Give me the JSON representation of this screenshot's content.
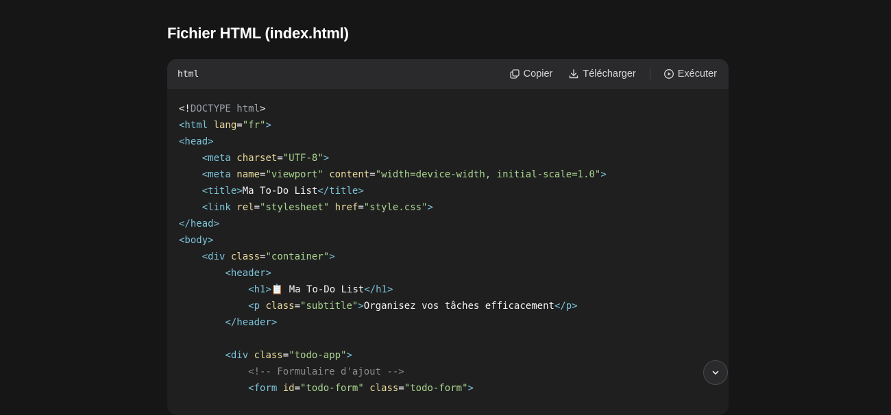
{
  "heading": "Fichier HTML (index.html)",
  "codeblock": {
    "language": "html",
    "copy_label": "Copier",
    "download_label": "Télécharger",
    "run_label": "Exécuter",
    "lines": [
      [
        [
          "p",
          "<!"
        ],
        [
          "d",
          "DOCTYPE html"
        ],
        [
          "p",
          ">"
        ]
      ],
      [
        [
          "t",
          "<html "
        ],
        [
          "a",
          "lang"
        ],
        [
          "p",
          "="
        ],
        [
          "s",
          "\"fr\""
        ],
        [
          "t",
          ">"
        ]
      ],
      [
        [
          "t",
          "<head>"
        ]
      ],
      [
        [
          "p",
          "    "
        ],
        [
          "t",
          "<meta "
        ],
        [
          "a",
          "charset"
        ],
        [
          "p",
          "="
        ],
        [
          "s",
          "\"UTF-8\""
        ],
        [
          "t",
          ">"
        ]
      ],
      [
        [
          "p",
          "    "
        ],
        [
          "t",
          "<meta "
        ],
        [
          "a",
          "name"
        ],
        [
          "p",
          "="
        ],
        [
          "s",
          "\"viewport\""
        ],
        [
          "p",
          " "
        ],
        [
          "a",
          "content"
        ],
        [
          "p",
          "="
        ],
        [
          "s",
          "\"width=device-width, initial-scale=1.0\""
        ],
        [
          "t",
          ">"
        ]
      ],
      [
        [
          "p",
          "    "
        ],
        [
          "t",
          "<title>"
        ],
        [
          "p",
          "Ma To-Do List"
        ],
        [
          "t",
          "</title>"
        ]
      ],
      [
        [
          "p",
          "    "
        ],
        [
          "t",
          "<link "
        ],
        [
          "a",
          "rel"
        ],
        [
          "p",
          "="
        ],
        [
          "s",
          "\"stylesheet\""
        ],
        [
          "p",
          " "
        ],
        [
          "a",
          "href"
        ],
        [
          "p",
          "="
        ],
        [
          "s",
          "\"style.css\""
        ],
        [
          "t",
          ">"
        ]
      ],
      [
        [
          "t",
          "</head>"
        ]
      ],
      [
        [
          "t",
          "<body>"
        ]
      ],
      [
        [
          "p",
          "    "
        ],
        [
          "t",
          "<div "
        ],
        [
          "a",
          "class"
        ],
        [
          "p",
          "="
        ],
        [
          "s",
          "\"container\""
        ],
        [
          "t",
          ">"
        ]
      ],
      [
        [
          "p",
          "        "
        ],
        [
          "t",
          "<header>"
        ]
      ],
      [
        [
          "p",
          "            "
        ],
        [
          "t",
          "<h1>"
        ],
        [
          "p",
          "📋 Ma To-Do List"
        ],
        [
          "t",
          "</h1>"
        ]
      ],
      [
        [
          "p",
          "            "
        ],
        [
          "t",
          "<p "
        ],
        [
          "a",
          "class"
        ],
        [
          "p",
          "="
        ],
        [
          "s",
          "\"subtitle\""
        ],
        [
          "t",
          ">"
        ],
        [
          "p",
          "Organisez vos tâches efficacement"
        ],
        [
          "t",
          "</p>"
        ]
      ],
      [
        [
          "p",
          "        "
        ],
        [
          "t",
          "</header>"
        ]
      ],
      [
        [
          "p",
          ""
        ]
      ],
      [
        [
          "p",
          "        "
        ],
        [
          "t",
          "<div "
        ],
        [
          "a",
          "class"
        ],
        [
          "p",
          "="
        ],
        [
          "s",
          "\"todo-app\""
        ],
        [
          "t",
          ">"
        ]
      ],
      [
        [
          "p",
          "            "
        ],
        [
          "c",
          "<!-- Formulaire d'ajout -->"
        ]
      ],
      [
        [
          "p",
          "            "
        ],
        [
          "t",
          "<form "
        ],
        [
          "a",
          "id"
        ],
        [
          "p",
          "="
        ],
        [
          "s",
          "\"todo-form\""
        ],
        [
          "p",
          " "
        ],
        [
          "a",
          "class"
        ],
        [
          "p",
          "="
        ],
        [
          "s",
          "\"todo-form\""
        ],
        [
          "t",
          ">"
        ]
      ]
    ]
  },
  "icons": {
    "copy": "copy-icon",
    "download": "download-icon",
    "run": "play-circle-icon",
    "scroll": "chevron-down-icon"
  }
}
